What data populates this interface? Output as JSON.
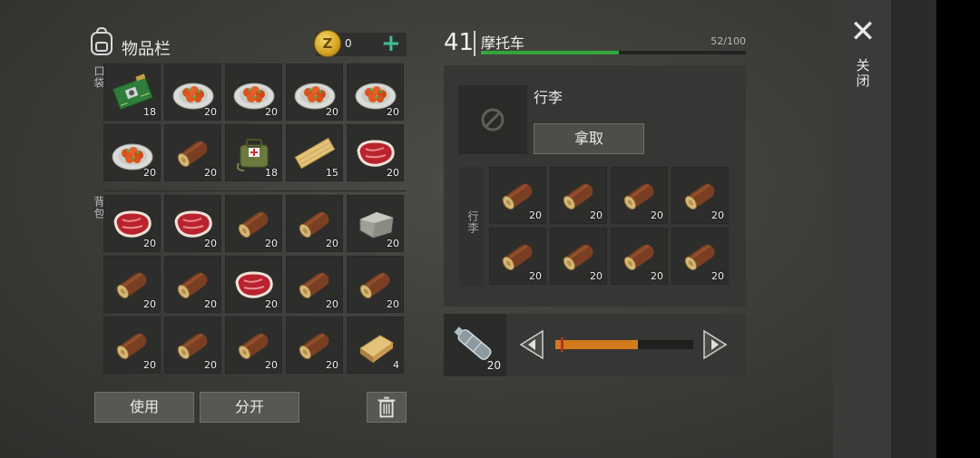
{
  "inventory": {
    "title": "物品栏",
    "coins": "0",
    "coin_symbol": "Z",
    "add_symbol": "+",
    "pocket_label": "口袋",
    "backpack_label": "背包",
    "pocket_items": [
      {
        "icon": "circuit-board-icon",
        "count": "18"
      },
      {
        "icon": "food-plate-icon",
        "count": "20"
      },
      {
        "icon": "food-plate-icon",
        "count": "20"
      },
      {
        "icon": "food-plate-icon",
        "count": "20"
      },
      {
        "icon": "food-plate-icon",
        "count": "20"
      },
      {
        "icon": "food-plate-icon",
        "count": "20"
      },
      {
        "icon": "log-icon",
        "count": "20"
      },
      {
        "icon": "medkit-bag-icon",
        "count": "18"
      },
      {
        "icon": "plank-icon",
        "count": "15"
      },
      {
        "icon": "raw-meat-icon",
        "count": "20"
      }
    ],
    "backpack_items": [
      {
        "icon": "raw-meat-icon",
        "count": "20"
      },
      {
        "icon": "raw-meat-icon",
        "count": "20"
      },
      {
        "icon": "log-icon",
        "count": "20"
      },
      {
        "icon": "log-icon",
        "count": "20"
      },
      {
        "icon": "stone-icon",
        "count": "20"
      },
      {
        "icon": "log-icon",
        "count": "20"
      },
      {
        "icon": "log-icon",
        "count": "20"
      },
      {
        "icon": "raw-meat-icon",
        "count": "20"
      },
      {
        "icon": "log-icon",
        "count": "20"
      },
      {
        "icon": "log-icon",
        "count": "20"
      },
      {
        "icon": "log-icon",
        "count": "20"
      },
      {
        "icon": "log-icon",
        "count": "20"
      },
      {
        "icon": "log-icon",
        "count": "20"
      },
      {
        "icon": "log-icon",
        "count": "20"
      },
      {
        "icon": "plank-block-icon",
        "count": "4"
      }
    ],
    "use_label": "使用",
    "split_label": "分开"
  },
  "vehicle": {
    "level": "41",
    "name": "摩托车",
    "durability": "52/100",
    "durability_fraction": 0.52,
    "luggage_title": "行李",
    "take_label": "拿取",
    "luggage_side_label": "行李",
    "luggage_items": [
      {
        "icon": "log-icon",
        "count": "20"
      },
      {
        "icon": "log-icon",
        "count": "20"
      },
      {
        "icon": "log-icon",
        "count": "20"
      },
      {
        "icon": "log-icon",
        "count": "20"
      },
      {
        "icon": "log-icon",
        "count": "20"
      },
      {
        "icon": "log-icon",
        "count": "20"
      },
      {
        "icon": "log-icon",
        "count": "20"
      },
      {
        "icon": "log-icon",
        "count": "20"
      }
    ],
    "fuel_item": {
      "icon": "water-bottle-icon",
      "count": "20"
    },
    "fuel_fraction": 0.6,
    "fuel_marker_fraction": 0.04
  },
  "close_label": "关闭",
  "colors": {
    "durability_bar": "#33a63b",
    "fuel_bar": "#d27a1c",
    "coin_add": "#3fbf9a"
  }
}
